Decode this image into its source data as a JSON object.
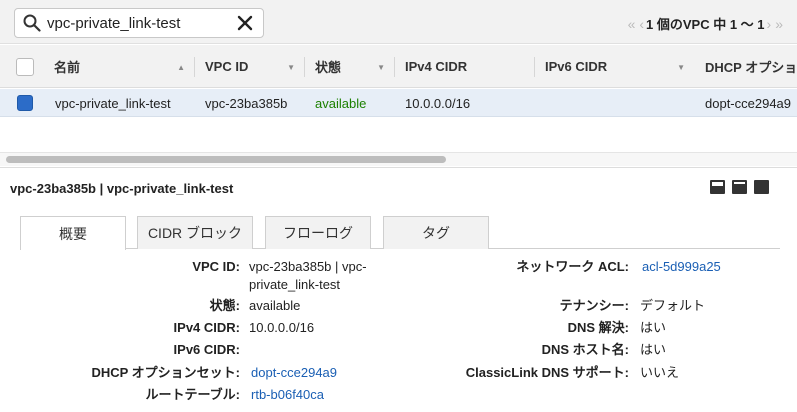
{
  "search": {
    "value": "vpc-private_link-test"
  },
  "pager": {
    "text": "1 個のVPC 中 1 〜 1"
  },
  "table": {
    "columns": [
      "名前",
      "VPC ID",
      "状態",
      "IPv4 CIDR",
      "IPv6 CIDR",
      "DHCP オプショ"
    ],
    "row": {
      "name": "vpc-private_link-test",
      "vpc_id": "vpc-23ba385b",
      "state": "available",
      "ipv4": "10.0.0.0/16",
      "ipv6": "",
      "dhcp": "dopt-cce294a9"
    }
  },
  "detail": {
    "title": "vpc-23ba385b | vpc-private_link-test",
    "tabs": [
      "概要",
      "CIDR ブロック",
      "フローログ",
      "タグ"
    ],
    "left": [
      {
        "label": "VPC ID:",
        "value": "vpc-23ba385b | vpc-",
        "value2": "private_link-test"
      },
      {
        "label": "状態:",
        "value": "available"
      },
      {
        "label": "IPv4 CIDR:",
        "value": "10.0.0.0/16"
      },
      {
        "label": "IPv6 CIDR:",
        "value": ""
      },
      {
        "label": "DHCP オプションセット:",
        "value": "dopt-cce294a9"
      },
      {
        "label": "ルートテーブル:",
        "value": "rtb-b06f40ca"
      }
    ],
    "right": [
      {
        "label": "ネットワーク ACL:",
        "value": "acl-5d999a25"
      },
      {
        "label": "テナンシー:",
        "value": "デフォルト"
      },
      {
        "label": "DNS 解決:",
        "value": "はい"
      },
      {
        "label": "DNS ホスト名:",
        "value": "はい"
      },
      {
        "label": "ClassicLink DNS サポート:",
        "value": "いいえ"
      }
    ]
  },
  "colors": {
    "accent": "#2c6cc8",
    "link": "#1a5fb4",
    "available": "#1d8102",
    "selected_row": "#e7eef7"
  }
}
